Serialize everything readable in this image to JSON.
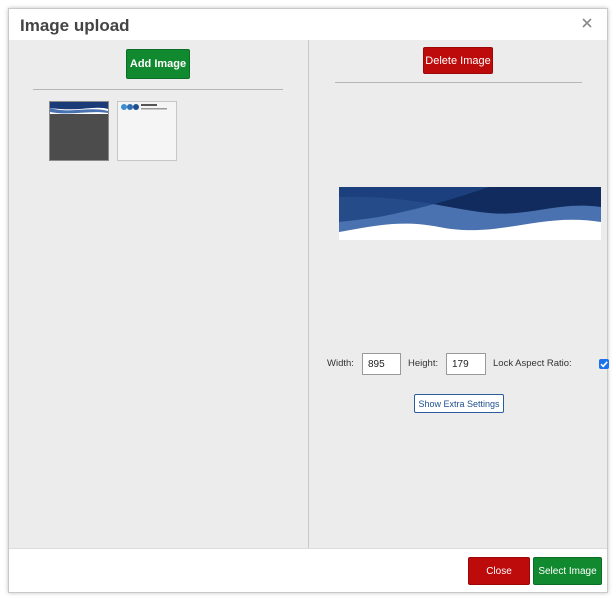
{
  "dialog": {
    "title": "Image upload",
    "close_icon": "close-icon"
  },
  "left": {
    "add_button_label": "Add Image"
  },
  "right": {
    "delete_button_label": "Delete Image",
    "width_label": "Width:",
    "width_value": "895",
    "height_label": "Height:",
    "height_value": "179",
    "lock_label": "Lock Aspect Ratio:",
    "lock_checked": true,
    "extra_settings_label": "Show Extra Settings"
  },
  "footer": {
    "close_label": "Close",
    "select_label": "Select Image"
  },
  "colors": {
    "green": "#11892f",
    "red": "#bd0a0a",
    "banner_dark": "#112b5f",
    "banner_light": "#4a72b0"
  }
}
